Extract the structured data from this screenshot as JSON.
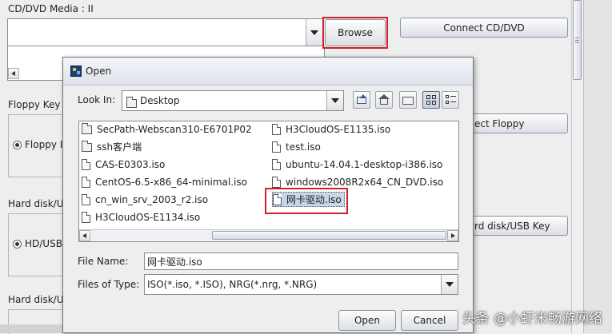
{
  "background": {
    "cddvd_label": "CD/DVD Media : II",
    "browse_label": "Browse",
    "connect_cddvd_label": "Connect CD/DVD",
    "floppy_group_label": "Floppy Key M",
    "floppy_radio_label": "Floppy In",
    "connect_floppy_label": "ect Floppy",
    "harddisk_group_label": "Hard disk/US",
    "hdusb_radio_label": "HD/USB",
    "connect_harddisk_label": "rd disk/USB Key",
    "harddisk_group2_label": "Hard disk/US"
  },
  "dialog": {
    "title": "Open",
    "look_in_label": "Look In:",
    "look_in_value": "Desktop",
    "files": [
      {
        "name": "SecPath-Webscan310-E6701P02",
        "type": "folder"
      },
      {
        "name": "ssh客户端",
        "type": "folder"
      },
      {
        "name": "CAS-E0303.iso",
        "type": "file"
      },
      {
        "name": "CentOS-6.5-x86_64-minimal.iso",
        "type": "file"
      },
      {
        "name": "cn_win_srv_2003_r2.iso",
        "type": "file"
      },
      {
        "name": "H3CloudOS-E1134.iso",
        "type": "file"
      },
      {
        "name": "H3CloudOS-E1135.iso",
        "type": "file"
      },
      {
        "name": "test.iso",
        "type": "file"
      },
      {
        "name": "ubuntu-14.04.1-desktop-i386.iso",
        "type": "file"
      },
      {
        "name": "windows2008R2x64_CN_DVD.iso",
        "type": "file"
      },
      {
        "name": "网卡驱动.iso",
        "type": "file",
        "selected": true
      }
    ],
    "file_name_label": "File Name:",
    "file_name_value": "网卡驱动.iso",
    "files_of_type_label": "Files of Type:",
    "files_of_type_value": "ISO(*.iso, *.ISO), NRG(*.nrg, *.NRG)",
    "open_label": "Open",
    "cancel_label": "Cancel"
  },
  "watermark": "头条 @小虾米畅游网络",
  "colors": {
    "highlight": "#d0202a",
    "selection": "#c9d6e8",
    "dialog_bg": "#eeeeee"
  }
}
